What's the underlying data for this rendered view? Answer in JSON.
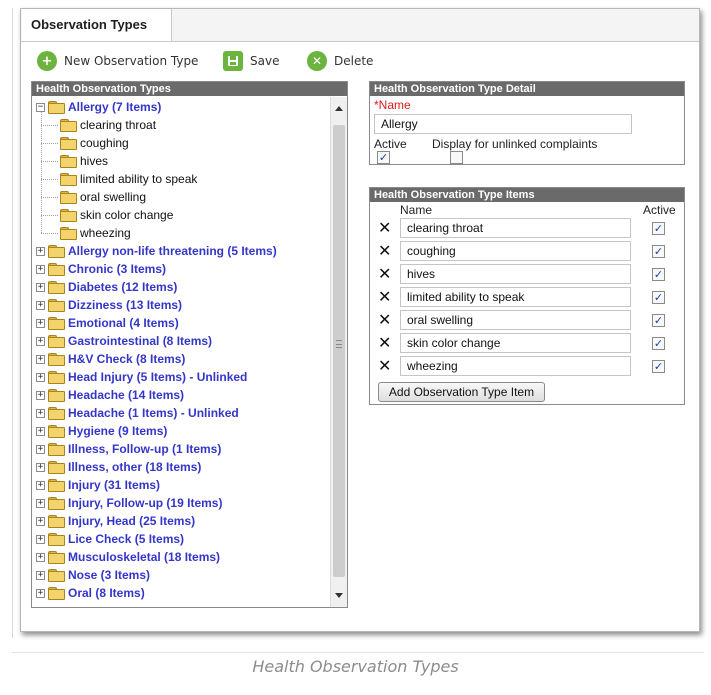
{
  "tab": {
    "label": "Observation Types"
  },
  "toolbar": {
    "new_label": "New Observation Type",
    "save_label": "Save",
    "delete_label": "Delete"
  },
  "tree_panel": {
    "title": "Health Observation Types",
    "expanded_group": {
      "label": "Allergy (7 Items)",
      "children": [
        "clearing throat",
        "coughing",
        "hives",
        "limited ability to speak",
        "oral swelling",
        "skin color change",
        "wheezing"
      ]
    },
    "groups": [
      "Allergy non-life threatening (5 Items)",
      "Chronic (3 Items)",
      "Diabetes (12 Items)",
      "Dizziness (13 Items)",
      "Emotional (4 Items)",
      "Gastrointestinal (8 Items)",
      "H&V Check (8 Items)",
      "Head Injury (5 Items) - Unlinked",
      "Headache (14 Items)",
      "Headache (1 Items) - Unlinked",
      "Hygiene (9 Items)",
      "Illness, Follow-up (1 Items)",
      "Illness, other (18 Items)",
      "Injury (31 Items)",
      "Injury, Follow-up (19 Items)",
      "Injury, Head (25 Items)",
      "Lice Check (5 Items)",
      "Musculoskeletal (18 Items)",
      "Nose (3 Items)",
      "Oral (8 Items)"
    ]
  },
  "detail_panel": {
    "title": "Health Observation Type Detail",
    "name_required_marker": "*",
    "name_label": "Name",
    "name_value": "Allergy",
    "active_label": "Active",
    "display_label": "Display for unlinked complaints",
    "active_checked": true,
    "display_checked": false
  },
  "items_panel": {
    "title": "Health Observation Type Items",
    "col_name": "Name",
    "col_active": "Active",
    "items": [
      {
        "name": "clearing throat",
        "active": true
      },
      {
        "name": "coughing",
        "active": true
      },
      {
        "name": "hives",
        "active": true
      },
      {
        "name": "limited ability to speak",
        "active": true
      },
      {
        "name": "oral swelling",
        "active": true
      },
      {
        "name": "skin color change",
        "active": true
      },
      {
        "name": "wheezing",
        "active": true
      }
    ],
    "add_button_label": "Add Observation Type Item"
  },
  "caption": "Health Observation Types",
  "icons": {
    "new": "plus-circle-icon",
    "save": "floppy-icon",
    "delete": "x-circle-icon",
    "remove_item": "x-icon",
    "folder": "folder-icon"
  },
  "colors": {
    "accent_green": "#6db33f",
    "group_link": "#3436c9",
    "panel_header": "#6a6a6a",
    "required": "#e01a1a"
  }
}
